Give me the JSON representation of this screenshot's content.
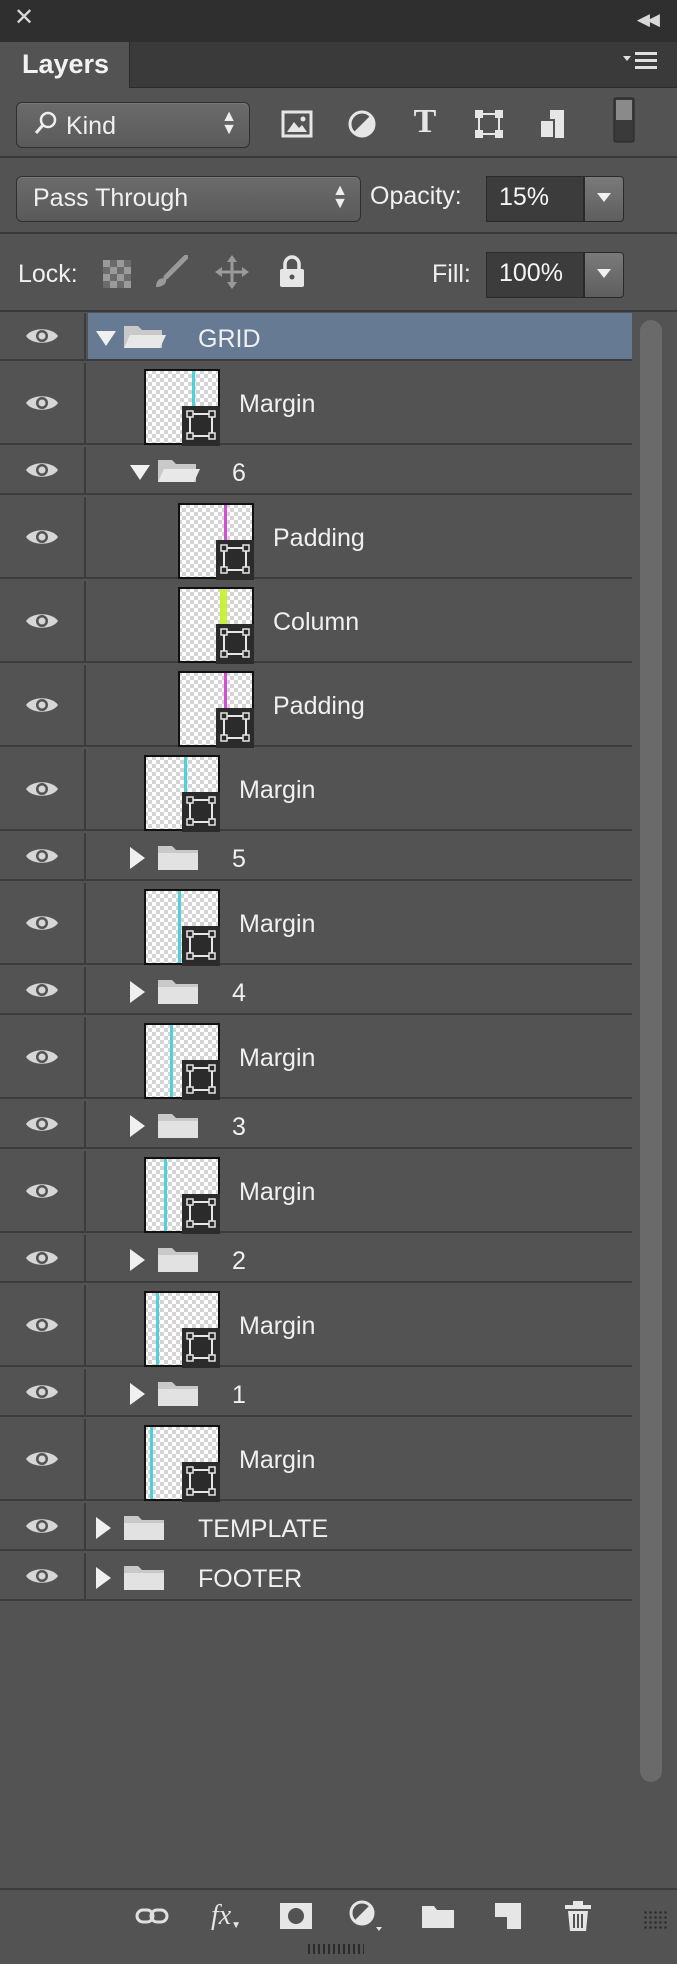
{
  "panel": {
    "tab_label": "Layers",
    "close_icon": "close-icon",
    "collapse_icon": "collapse-icon",
    "menu_icon": "panel-menu-icon"
  },
  "filter": {
    "kind_label": "Kind",
    "icons": [
      "pixel-filter-icon",
      "adjustment-filter-icon",
      "type-filter-icon",
      "shape-filter-icon",
      "smart-object-filter-icon",
      "filter-toggle-icon"
    ]
  },
  "blend": {
    "mode": "Pass Through",
    "opacity_label": "Opacity:",
    "opacity_value": "15%"
  },
  "lock": {
    "label": "Lock:",
    "icons": [
      "lock-transparent-icon",
      "lock-pixels-icon",
      "lock-position-icon",
      "lock-all-icon"
    ],
    "fill_label": "Fill:",
    "fill_value": "100%"
  },
  "layers": [
    {
      "type": "group",
      "name": "GRID",
      "expanded": true,
      "depth": 0,
      "selected": true
    },
    {
      "type": "shape",
      "name": "Margin",
      "depth": 1,
      "line_color": "#4fd1d9"
    },
    {
      "type": "group",
      "name": "6",
      "expanded": true,
      "depth": 1
    },
    {
      "type": "shape",
      "name": "Padding",
      "depth": 2,
      "line_color": "#d050d8"
    },
    {
      "type": "shape",
      "name": "Column",
      "depth": 2,
      "line_color": "#c8f03c"
    },
    {
      "type": "shape",
      "name": "Padding",
      "depth": 2,
      "line_color": "#d050d8"
    },
    {
      "type": "shape",
      "name": "Margin",
      "depth": 1,
      "line_color": "#4fd1d9"
    },
    {
      "type": "group",
      "name": "5",
      "expanded": false,
      "depth": 1
    },
    {
      "type": "shape",
      "name": "Margin",
      "depth": 1,
      "line_color": "#4fd1d9"
    },
    {
      "type": "group",
      "name": "4",
      "expanded": false,
      "depth": 1
    },
    {
      "type": "shape",
      "name": "Margin",
      "depth": 1,
      "line_color": "#4fd1d9"
    },
    {
      "type": "group",
      "name": "3",
      "expanded": false,
      "depth": 1
    },
    {
      "type": "shape",
      "name": "Margin",
      "depth": 1,
      "line_color": "#4fd1d9"
    },
    {
      "type": "group",
      "name": "2",
      "expanded": false,
      "depth": 1
    },
    {
      "type": "shape",
      "name": "Margin",
      "depth": 1,
      "line_color": "#4fd1d9"
    },
    {
      "type": "group",
      "name": "1",
      "expanded": false,
      "depth": 1
    },
    {
      "type": "shape",
      "name": "Margin",
      "depth": 1,
      "line_color": "#4fd1d9"
    },
    {
      "type": "group",
      "name": "TEMPLATE",
      "expanded": false,
      "depth": 0
    },
    {
      "type": "group",
      "name": "FOOTER",
      "expanded": false,
      "depth": 0
    }
  ],
  "footer_icons": [
    "link-layers-icon",
    "layer-style-icon",
    "layer-mask-icon",
    "adjustment-layer-icon",
    "new-group-icon",
    "new-layer-icon",
    "delete-layer-icon"
  ],
  "colors": {
    "panel_bg": "#535353",
    "selection": "#677a94",
    "margin_line": "#4fd1d9",
    "padding_line": "#d050d8",
    "column_line": "#c8f03c"
  }
}
